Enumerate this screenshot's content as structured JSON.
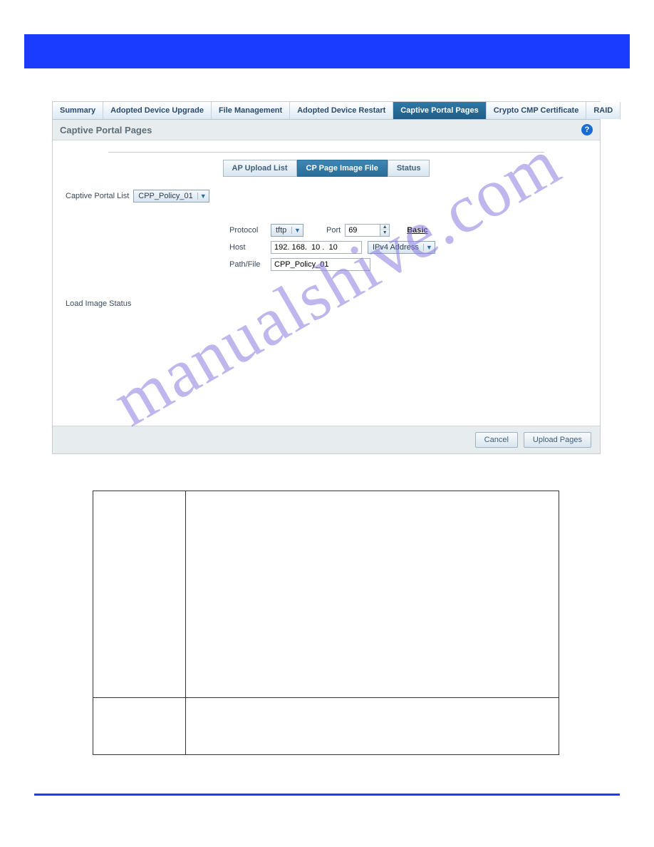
{
  "branding": {
    "watermark": "manualshive.com"
  },
  "tabs": [
    {
      "label": "Summary"
    },
    {
      "label": "Adopted Device Upgrade"
    },
    {
      "label": "File Management"
    },
    {
      "label": "Adopted Device Restart"
    },
    {
      "label": "Captive Portal Pages",
      "active": true
    },
    {
      "label": "Crypto CMP Certificate"
    },
    {
      "label": "RAID"
    }
  ],
  "page": {
    "title": "Captive Portal Pages"
  },
  "subtabs": [
    {
      "label": "AP Upload List"
    },
    {
      "label": "CP Page Image File",
      "active": true
    },
    {
      "label": "Status"
    }
  ],
  "form": {
    "captive_list_label": "Captive Portal List",
    "captive_list_value": "CPP_Policy_01",
    "protocol_label": "Protocol",
    "protocol_value": "tftp",
    "port_label": "Port",
    "port_value": "69",
    "basic_link": "Basic",
    "host_label": "Host",
    "host_value": "192. 168.  10 .  10",
    "addr_type_value": "IPv4 Address",
    "pathfile_label": "Path/File",
    "pathfile_value": "CPP_Policy_01",
    "status_label": "Load Image Status"
  },
  "footer": {
    "cancel": "Cancel",
    "upload": "Upload Pages"
  }
}
